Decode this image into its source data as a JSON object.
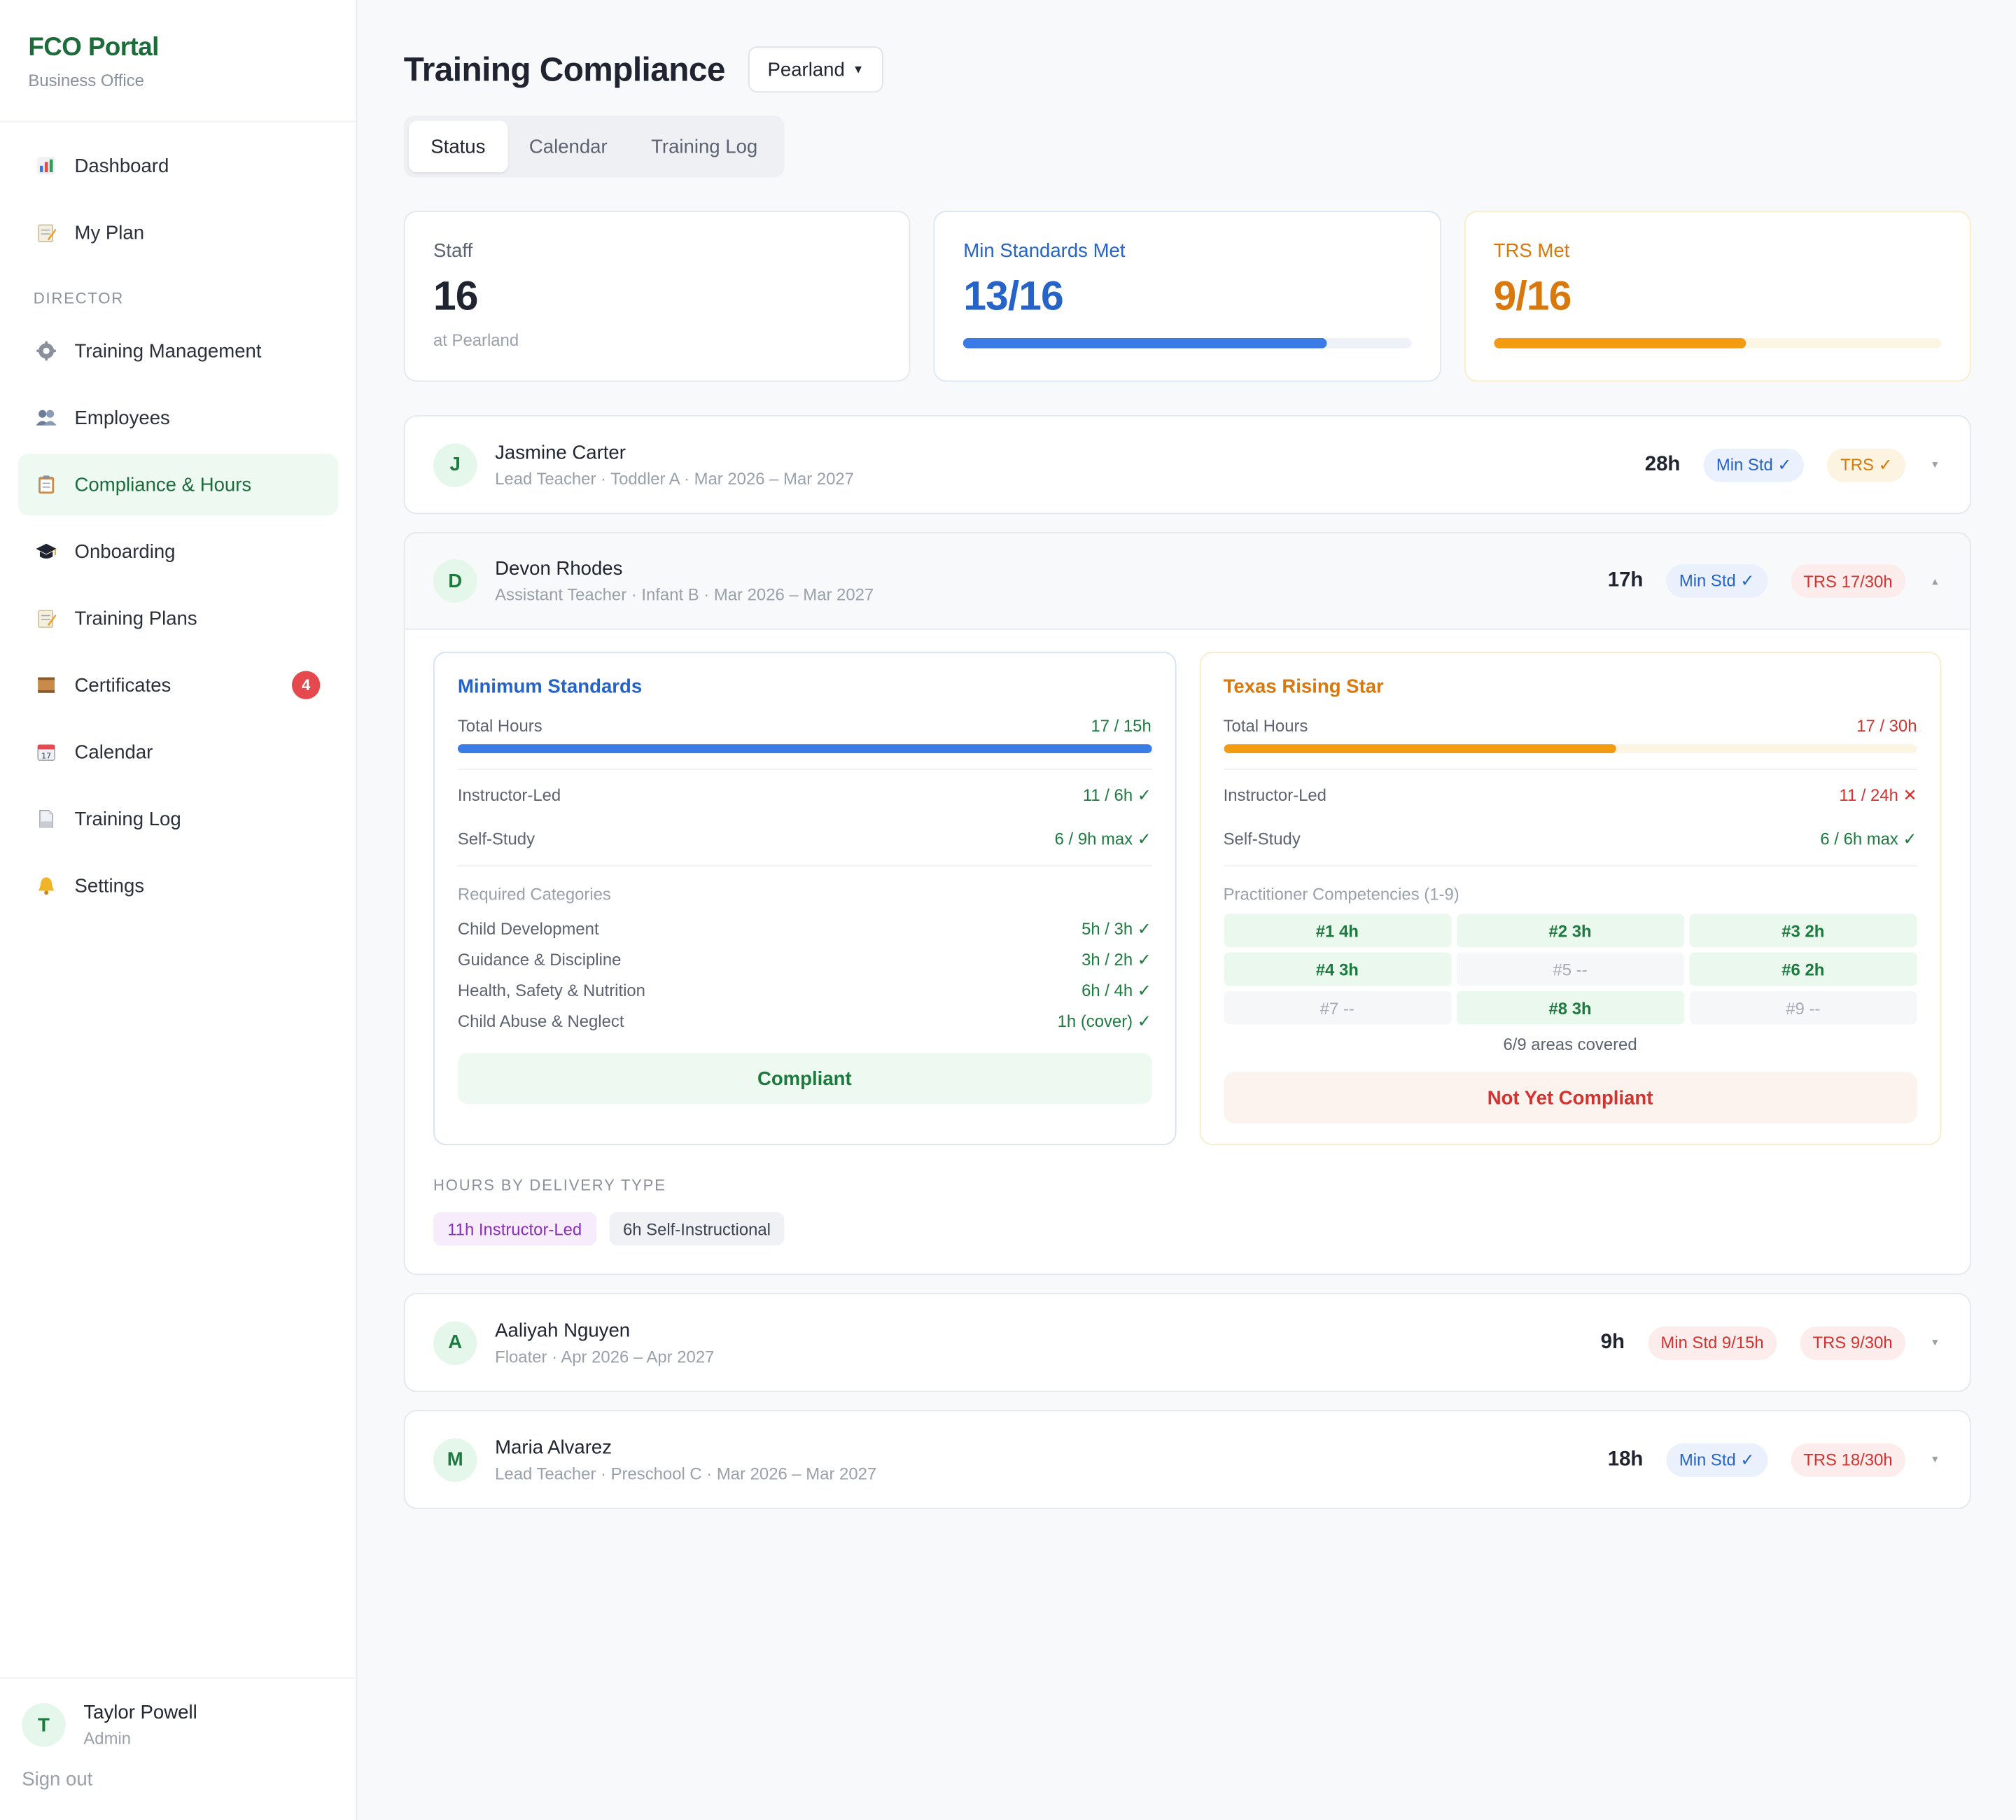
{
  "brand": {
    "title": "FCO Portal",
    "subtitle": "Business Office"
  },
  "nav": {
    "top": [
      {
        "label": "Dashboard",
        "icon": "chart-icon"
      },
      {
        "label": "My Plan",
        "icon": "memo-icon"
      }
    ],
    "section_label": "DIRECTOR",
    "director": [
      {
        "label": "Training Management",
        "icon": "gear-icon"
      },
      {
        "label": "Employees",
        "icon": "people-icon"
      },
      {
        "label": "Compliance & Hours",
        "icon": "clipboard-icon",
        "active": true
      },
      {
        "label": "Onboarding",
        "icon": "grad-cap-icon"
      },
      {
        "label": "Training Plans",
        "icon": "memo-icon"
      },
      {
        "label": "Certificates",
        "icon": "certificate-icon",
        "badge": "4"
      },
      {
        "label": "Calendar",
        "icon": "calendar-icon"
      },
      {
        "label": "Training Log",
        "icon": "document-icon"
      },
      {
        "label": "Settings",
        "icon": "bell-icon"
      }
    ]
  },
  "user": {
    "initial": "T",
    "name": "Taylor Powell",
    "role": "Admin",
    "signout": "Sign out"
  },
  "header": {
    "title": "Training Compliance",
    "location": "Pearland"
  },
  "tabs": [
    {
      "label": "Status",
      "active": true
    },
    {
      "label": "Calendar"
    },
    {
      "label": "Training Log"
    }
  ],
  "stats": {
    "staff": {
      "label": "Staff",
      "value": "16",
      "sub": "at Pearland"
    },
    "min_std": {
      "label": "Min Standards Met",
      "value": "13/16",
      "progress": 0.8125
    },
    "trs": {
      "label": "TRS Met",
      "value": "9/16",
      "progress": 0.5625
    }
  },
  "employees": [
    {
      "initial": "J",
      "name": "Jasmine Carter",
      "meta": "Lead Teacher · Toddler A · Mar 2026 – Mar 2027",
      "hours": "28h",
      "min_pill": "Min Std ✓",
      "trs_pill": "TRS ✓",
      "chevron": "▾"
    },
    {
      "initial": "D",
      "name": "Devon Rhodes",
      "meta": "Assistant Teacher · Infant B · Mar 2026 – Mar 2027",
      "hours": "17h",
      "min_pill": "Min Std ✓",
      "trs_pill": "TRS 17/30h",
      "chevron": "▴"
    },
    {
      "initial": "A",
      "name": "Aaliyah Nguyen",
      "meta": "Floater · Apr 2026 – Apr 2027",
      "hours": "9h",
      "min_pill": "Min Std 9/15h",
      "trs_pill": "TRS 9/30h",
      "chevron": "▾"
    },
    {
      "initial": "M",
      "name": "Maria Alvarez",
      "meta": "Lead Teacher · Preschool C · Mar 2026 – Mar 2027",
      "hours": "18h",
      "min_pill": "Min Std ✓",
      "trs_pill": "TRS 18/30h",
      "chevron": "▾"
    }
  ],
  "detail": {
    "min": {
      "title": "Minimum Standards",
      "total_label": "Total Hours",
      "total_value": "17 / 15h",
      "progress": 1.0,
      "instructor_label": "Instructor-Led",
      "instructor_value": "11 / 6h ✓",
      "self_label": "Self-Study",
      "self_value": "6 / 9h max ✓",
      "categories_label": "Required Categories",
      "categories": [
        {
          "label": "Child Development",
          "value": "5h / 3h ✓"
        },
        {
          "label": "Guidance & Discipline",
          "value": "3h / 2h ✓"
        },
        {
          "label": "Health, Safety & Nutrition",
          "value": "6h / 4h ✓"
        },
        {
          "label": "Child Abuse & Neglect",
          "value": "1h (cover) ✓"
        }
      ],
      "status": "Compliant"
    },
    "trs": {
      "title": "Texas Rising Star",
      "total_label": "Total Hours",
      "total_value": "17 / 30h",
      "progress": 0.5667,
      "instructor_label": "Instructor-Led",
      "instructor_value": "11 / 24h ✕",
      "self_label": "Self-Study",
      "self_value": "6 / 6h max ✓",
      "competencies_label": "Practitioner Competencies (1-9)",
      "competencies": [
        {
          "label": "#1 4h",
          "covered": true
        },
        {
          "label": "#2 3h",
          "covered": true
        },
        {
          "label": "#3 2h",
          "covered": true
        },
        {
          "label": "#4 3h",
          "covered": true
        },
        {
          "label": "#5 --",
          "covered": false
        },
        {
          "label": "#6 2h",
          "covered": true
        },
        {
          "label": "#7 --",
          "covered": false
        },
        {
          "label": "#8 3h",
          "covered": true
        },
        {
          "label": "#9 --",
          "covered": false
        }
      ],
      "covered": "6/9 areas covered",
      "status": "Not Yet Compliant"
    },
    "delivery_label": "HOURS BY DELIVERY TYPE",
    "delivery": [
      {
        "label": "11h Instructor-Led"
      },
      {
        "label": "6h Self-Instructional"
      }
    ]
  },
  "colors": {
    "brand_green": "#1d6b3a",
    "blue": "#2563c9",
    "orange": "#d9780d",
    "red": "#d3322f"
  }
}
